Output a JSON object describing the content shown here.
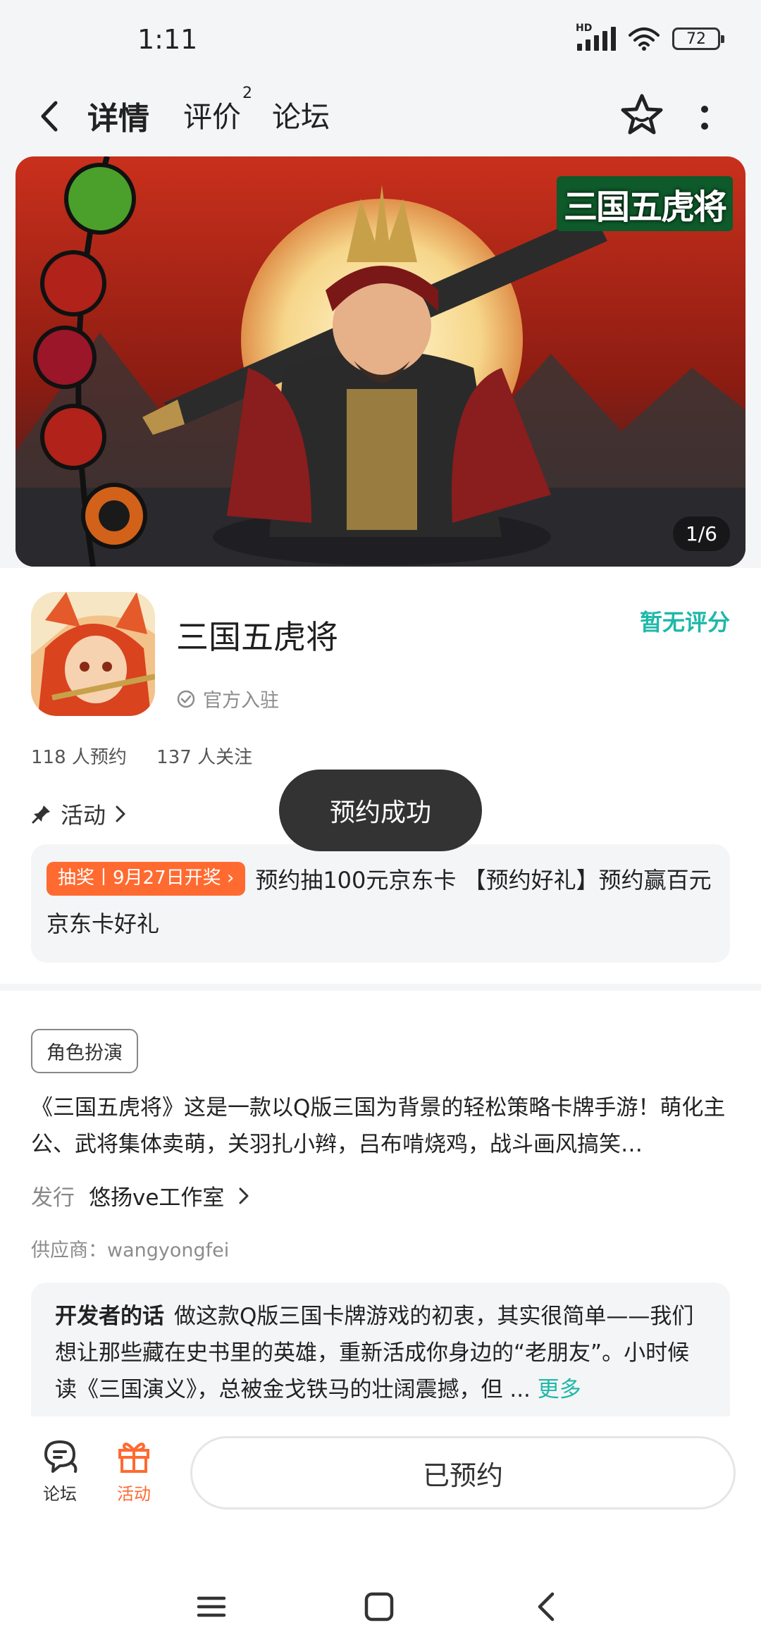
{
  "status_bar": {
    "time": "1:11",
    "network_label": "HD",
    "battery": "72"
  },
  "header": {
    "tabs": [
      {
        "label": "详情",
        "active": true
      },
      {
        "label": "评价",
        "badge": "2"
      },
      {
        "label": "论坛"
      }
    ],
    "icons": {
      "back": "chevron-left-icon",
      "favorite": "star-icon",
      "more": "more-vertical-icon"
    }
  },
  "banner": {
    "title": "三国五虎将",
    "counter": "1/6"
  },
  "app": {
    "name": "三国五虎将",
    "verified": "官方入驻",
    "rating": "暂无评分",
    "reservations": "118 人预约",
    "followers": "137 人关注"
  },
  "activity": {
    "label": "活动",
    "tag": "抽奖丨9月27日开奖",
    "text": "预约抽100元京东卡 【预约好礼】预约赢百元京东卡好礼"
  },
  "toast": "预约成功",
  "description": {
    "genre": "角色扮演",
    "intro": "《三国五虎将》这是一款以Q版三国为背景的轻松策略卡牌手游！萌化主公、武将集体卖萌，关羽扎小辫，吕布啃烧鸡，战斗画风搞笑…",
    "publisher_label": "发行",
    "publisher": "悠扬ve工作室",
    "supplier": "供应商：wangyongfei",
    "dev_label": "开发者的话",
    "dev_text": "做这款Q版三国卡牌游戏的初衷，其实很简单——我们想让那些藏在史书里的英雄，重新活成你身边的“老朋友”。小时候读《三国演义》，总被金戈铁马的壮阔震撼，但 ...",
    "more": "更多"
  },
  "bottom_bar": {
    "forum": "论坛",
    "activity": "活动",
    "reserve_button": "已预约"
  },
  "colors": {
    "accent": "#1fb8a8",
    "tab_underline": "#2fd3c3",
    "orange": "#ff6a30"
  }
}
